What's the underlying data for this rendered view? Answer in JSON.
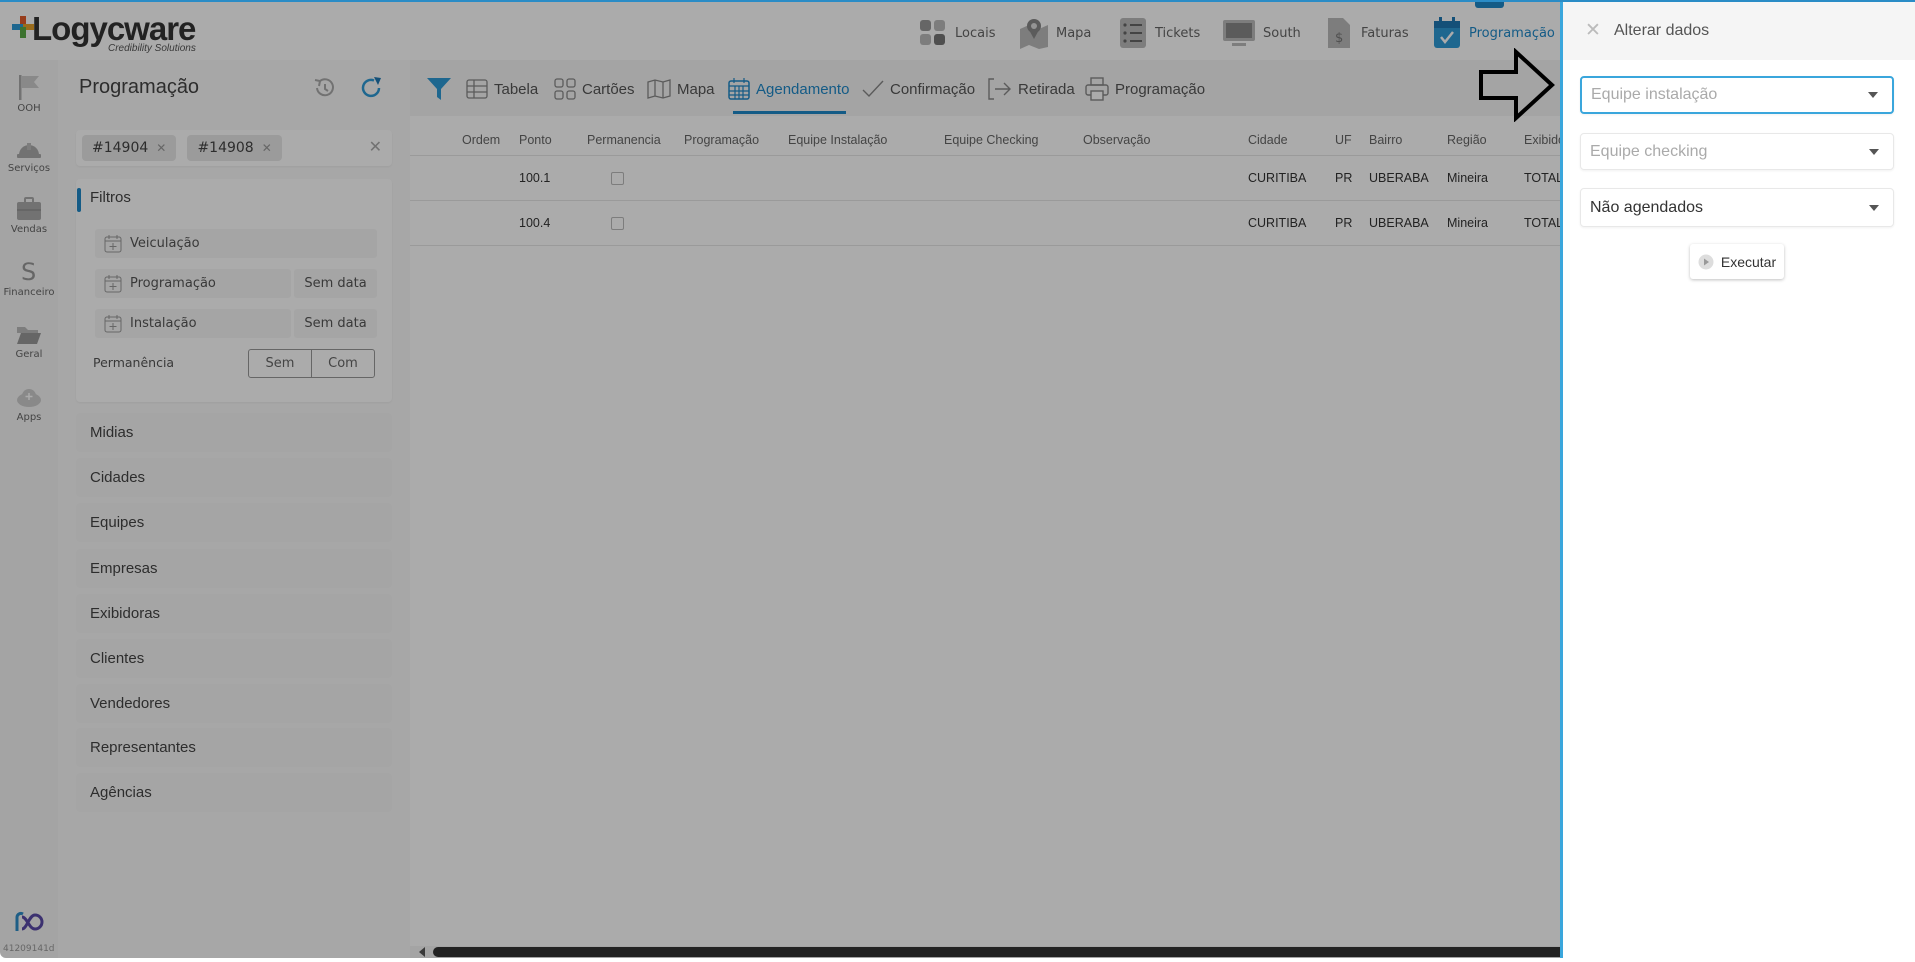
{
  "brand": {
    "name": "Logycware",
    "tagline": "Credibility Solutions",
    "accent": "#1e88c8"
  },
  "topnav": [
    {
      "label": "Locais",
      "icon": "grid-icon"
    },
    {
      "label": "Mapa",
      "icon": "map-pin-icon"
    },
    {
      "label": "Tickets",
      "icon": "checklist-icon"
    },
    {
      "label": "South",
      "icon": "monitor-icon"
    },
    {
      "label": "Faturas",
      "icon": "invoice-icon"
    },
    {
      "label": "Programação",
      "icon": "calendar-check-icon",
      "active": true
    }
  ],
  "sidebar": [
    {
      "label": "OOH",
      "icon": "flag-icon"
    },
    {
      "label": "Serviços",
      "icon": "helmet-icon"
    },
    {
      "label": "Vendas",
      "icon": "briefcase-icon"
    },
    {
      "label": "Financeiro",
      "icon": "dollar-icon"
    },
    {
      "label": "Geral",
      "icon": "folder-icon"
    },
    {
      "label": "Apps",
      "icon": "cloud-plus-icon"
    }
  ],
  "version": "41209141d",
  "filters": {
    "title": "Programação",
    "tags": [
      "#14904",
      "#14908"
    ],
    "section_title": "Filtros",
    "date_filters": [
      {
        "label": "Veiculação",
        "value": ""
      },
      {
        "label": "Programação",
        "value": "Sem data"
      },
      {
        "label": "Instalação",
        "value": "Sem data"
      }
    ],
    "permanencia": {
      "label": "Permanência",
      "options": [
        "Sem",
        "Com"
      ]
    },
    "accordions": [
      "Midias",
      "Cidades",
      "Equipes",
      "Empresas",
      "Exibidoras",
      "Clientes",
      "Vendedores",
      "Representantes",
      "Agências"
    ]
  },
  "toolbar": {
    "views": [
      {
        "label": "Tabela",
        "icon": "table-icon"
      },
      {
        "label": "Cartões",
        "icon": "cards-icon"
      },
      {
        "label": "Mapa",
        "icon": "map-icon"
      },
      {
        "label": "Agendamento",
        "icon": "calendar-icon",
        "active": true
      },
      {
        "label": "Confirmação",
        "icon": "check-icon"
      },
      {
        "label": "Retirada",
        "icon": "exit-icon"
      },
      {
        "label": "Programação",
        "icon": "printer-icon"
      }
    ]
  },
  "table": {
    "columns": [
      "Ordem",
      "Ponto",
      "Permanencia",
      "Programação",
      "Equipe Instalação",
      "Equipe Checking",
      "Observação",
      "Cidade",
      "UF",
      "Bairro",
      "Região",
      "Exibido"
    ],
    "rows": [
      {
        "ordem": "",
        "ponto": "100.1",
        "permanencia": false,
        "cidade": "CURITIBA",
        "uf": "PR",
        "bairro": "UBERABA",
        "regiao": "Mineira",
        "exibido": "TOTAL"
      },
      {
        "ordem": "",
        "ponto": "100.4",
        "permanencia": false,
        "cidade": "CURITIBA",
        "uf": "PR",
        "bairro": "UBERABA",
        "regiao": "Mineira",
        "exibido": "TOTAL"
      }
    ]
  },
  "panel": {
    "title": "Alterar dados",
    "equipe_instalacao_placeholder": "Equipe instalação",
    "equipe_checking_placeholder": "Equipe checking",
    "status_value": "Não agendados",
    "execute_label": "Executar"
  }
}
